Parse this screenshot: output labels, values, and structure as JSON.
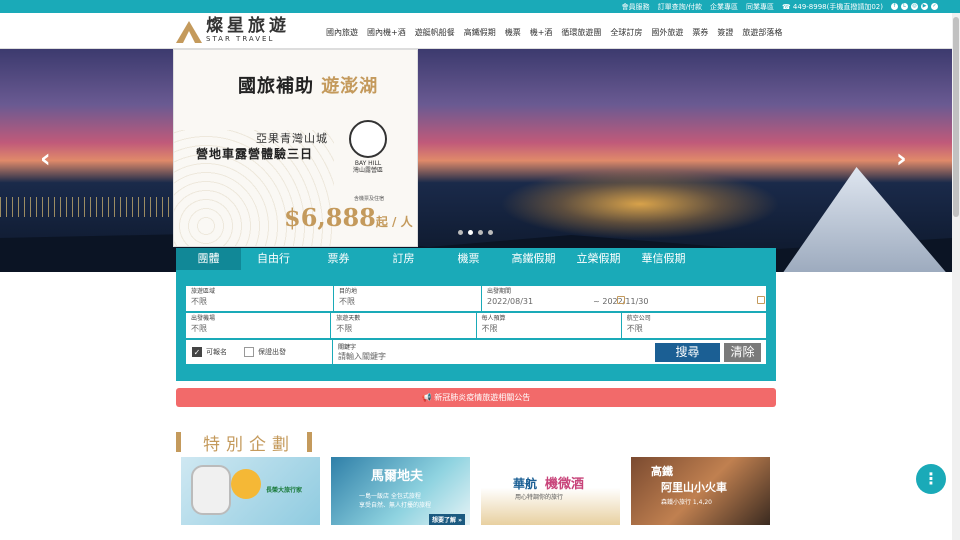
{
  "topbar": {
    "links": [
      "會員服務",
      "訂單查詢/付款",
      "企業專區",
      "同業專區"
    ],
    "phone": "449-8998(手機直撥請加02)",
    "social_icons": [
      "facebook-icon",
      "line-icon",
      "instagram-icon",
      "youtube-icon",
      "blog-icon"
    ]
  },
  "logo": {
    "zh": "燦星旅遊",
    "en": "STAR TRAVEL"
  },
  "nav": [
    "國內旅遊",
    "國內機+酒",
    "遊艇帆船餐",
    "高鐵假期",
    "機票",
    "機+酒",
    "循環旅遊團",
    "全球訂房",
    "國外旅遊",
    "票券",
    "簽證",
    "旅遊部落格"
  ],
  "hero": {
    "prev": "‹",
    "next": "›",
    "slides": 4,
    "active": 1
  },
  "ad": {
    "t1_a": "國旅補助",
    "t1_b": "遊澎湖",
    "t2": "亞果青灣山城",
    "t3": "營地車露營體驗三日",
    "badge": "灣山露營區",
    "badge_en": "BAY HILL",
    "note": "含機票及住宿",
    "price": "$6,888",
    "price_unit": "起 / 人"
  },
  "tabs": [
    "團體",
    "自由行",
    "票券",
    "訂房",
    "機票",
    "高鐵假期",
    "立榮假期",
    "華信假期"
  ],
  "active_tab": 0,
  "search": {
    "region": {
      "label": "旅遊區域",
      "value": "不限"
    },
    "dest": {
      "label": "目的地",
      "value": "不限"
    },
    "date": {
      "label": "出發期間",
      "from": "2022/08/31",
      "to": "2022/11/30",
      "sep": "~"
    },
    "airport": {
      "label": "出發機場",
      "value": "不限"
    },
    "days": {
      "label": "旅遊天數",
      "value": "不限"
    },
    "budget": {
      "label": "每人預算",
      "value": "不限"
    },
    "airline": {
      "label": "航空公司",
      "value": "不限"
    },
    "available": {
      "label": "可報名",
      "checked": true
    },
    "guaranteed": {
      "label": "保證出發",
      "checked": false
    },
    "keyword": {
      "label": "關鍵字",
      "placeholder": "請輸入關鍵字"
    },
    "submit": "搜尋",
    "clear": "清除"
  },
  "notice": "新冠肺炎疫情旅遊相關公告",
  "section": {
    "title": "特別企劃"
  },
  "cards": [
    {
      "title": "長榮大旅行家"
    },
    {
      "title": "馬爾地夫",
      "sub": "一島一飯店 全包式旅程",
      "sub2": "享受自然、無人打擾的旅程",
      "cta": "想要了解 »"
    },
    {
      "title": "華航",
      "title2": "機微酒",
      "sub": "用心特調你的旅行"
    },
    {
      "title": "高鐵",
      "title2": "阿里山小火車",
      "sub": "森鐵小旅行 1,4,20"
    }
  ]
}
